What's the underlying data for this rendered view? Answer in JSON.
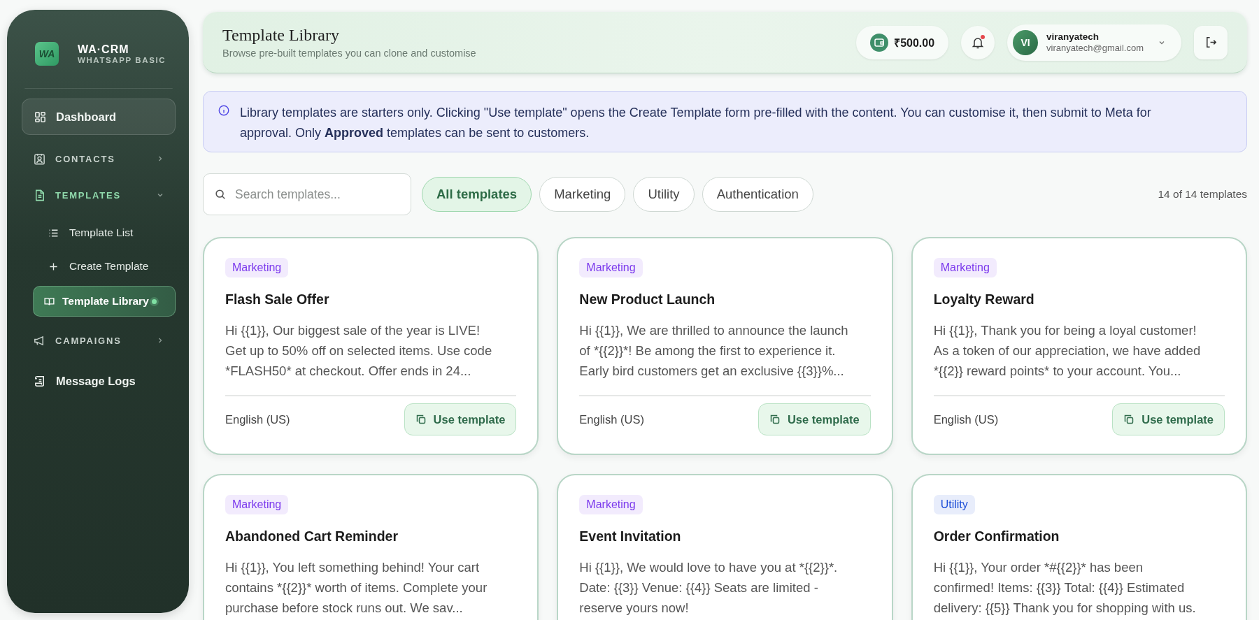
{
  "brand": {
    "name": "WA·CRM",
    "plan": "WHATSAPP BASIC",
    "logo_text": "WA"
  },
  "sidebar": {
    "items": [
      {
        "kind": "top",
        "label": "Dashboard",
        "focused": true
      },
      {
        "kind": "section",
        "label": "CONTACTS",
        "expanded": false
      },
      {
        "kind": "section",
        "label": "TEMPLATES",
        "expanded": true,
        "children": [
          {
            "label": "Template List",
            "selected": false
          },
          {
            "label": "Create Template",
            "selected": false
          },
          {
            "label": "Template Library",
            "selected": true
          }
        ]
      },
      {
        "kind": "section",
        "label": "CAMPAIGNS",
        "expanded": false
      },
      {
        "kind": "top",
        "label": "Message Logs",
        "focused": false
      }
    ]
  },
  "header": {
    "title": "Template Library",
    "subtitle": "Browse pre-built templates you can clone and customise",
    "wallet": "₹500.00",
    "notifications": {
      "unread": true
    },
    "user": {
      "initials": "VI",
      "name": "viranyatech",
      "email": "viranyatech@gmail.com"
    }
  },
  "notice": "Library templates are starters only. Clicking \"Use template\" opens the Create Template form pre-filled with the content. You can customise it, then submit to Meta for approval. Only **Approved** templates can be sent to customers.",
  "search": {
    "placeholder": "Search templates..."
  },
  "filters": [
    {
      "label": "All templates",
      "selected": true
    },
    {
      "label": "Marketing",
      "selected": false
    },
    {
      "label": "Utility",
      "selected": false
    },
    {
      "label": "Authentication",
      "selected": false
    }
  ],
  "count": "14 of 14 templates",
  "templates": [
    {
      "tag": {
        "label": "Marketing",
        "color": "#7c3aed"
      },
      "title": "Flash Sale Offer",
      "body": "Hi {{1}}, Our biggest sale of the year is LIVE! Get up to 50% off on selected items. Use code *FLASH50* at checkout. Offer ends in 24...",
      "language": "English (US)",
      "action": "Use template"
    },
    {
      "tag": {
        "label": "Marketing",
        "color": "#7c3aed"
      },
      "title": "New Product Launch",
      "body": "Hi {{1}}, We are thrilled to announce the launch of *{{2}}*! Be among the first to experience it. Early bird customers get an exclusive {{3}}%...",
      "language": "English (US)",
      "action": "Use template"
    },
    {
      "tag": {
        "label": "Marketing",
        "color": "#7c3aed"
      },
      "title": "Loyalty Reward",
      "body": "Hi {{1}}, Thank you for being a loyal customer! As a token of our appreciation, we have added *{{2}} reward points* to your account. You...",
      "language": "English (US)",
      "action": "Use template"
    },
    {
      "tag": {
        "label": "Marketing",
        "color": "#7c3aed"
      },
      "title": "Abandoned Cart Reminder",
      "body": "Hi {{1}}, You left something behind! Your cart contains *{{2}}* worth of items. Complete your purchase before stock runs out. We sav..."
    },
    {
      "tag": {
        "label": "Marketing",
        "color": "#7c3aed"
      },
      "title": "Event Invitation",
      "body": "Hi {{1}}, We would love to have you at *{{2}}*. Date: {{3}} Venue: {{4}} Seats are limited - reserve yours now!"
    },
    {
      "tag": {
        "label": "Utility",
        "color": "#1d4ed8"
      },
      "title": "Order Confirmation",
      "body": "Hi {{1}}, Your order *#{{2}}* has been confirmed! Items: {{3}} Total: {{4}} Estimated delivery: {{5}} Thank you for shopping with us."
    }
  ]
}
